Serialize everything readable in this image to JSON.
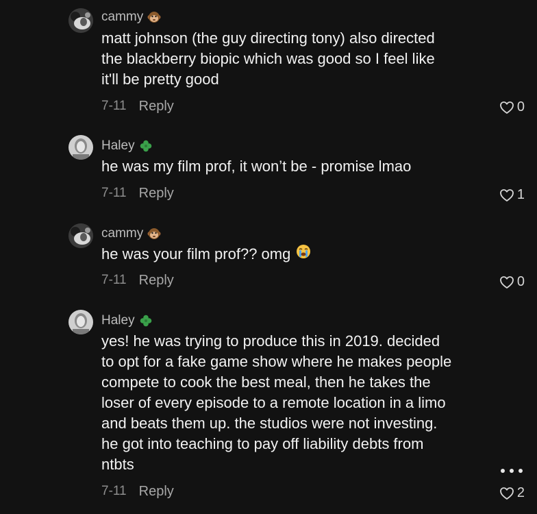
{
  "comments": [
    {
      "username": "cammy",
      "badge_icon": "monkey-face-icon",
      "lines": [
        "matt johnson (the guy directing tony) also directed",
        "the blackberry biopic which was good so I feel like",
        "it'll be pretty good"
      ],
      "date": "7-11",
      "reply_label": "Reply",
      "likes": "0"
    },
    {
      "username": "Haley",
      "badge_icon": "four-leaf-clover-icon",
      "lines": [
        "he was my film prof, it won’t be - promise lmao"
      ],
      "date": "7-11",
      "reply_label": "Reply",
      "likes": "1"
    },
    {
      "username": "cammy",
      "badge_icon": "monkey-face-icon",
      "lines": [
        "he was your film prof?? omg"
      ],
      "emoji": "loudly-crying-face-icon",
      "date": "7-11",
      "reply_label": "Reply",
      "likes": "0"
    },
    {
      "username": "Haley",
      "badge_icon": "four-leaf-clover-icon",
      "lines": [
        "yes! he was trying to produce this in 2019. decided",
        "to opt for a fake game show where he makes people",
        "compete to cook the best meal, then he takes the",
        "loser of every episode to a remote location in a limo",
        "and beats them up. the studios were not investing.",
        "he got into teaching to pay off liability debts from",
        "ntbts"
      ],
      "date": "7-11",
      "reply_label": "Reply",
      "likes": "2"
    }
  ],
  "more_icon": "more-horizontal-icon",
  "colors": {
    "background": "#121212",
    "text": "#f2f2f2",
    "username": "#bdbdbd",
    "meta": "#8e8e8e"
  }
}
